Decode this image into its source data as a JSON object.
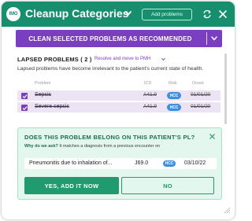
{
  "header": {
    "logo_text": "IMO",
    "title": "Cleanup Categories",
    "add_problems_label": "Add problems",
    "icons": [
      "chevron-down-icon",
      "refresh-icon",
      "close-icon"
    ]
  },
  "action_button": {
    "label": "CLEAN SELECTED PROBLEMS AS RECOMMENDED"
  },
  "lapsed": {
    "title": "LAPSED PROBLEMS ( 2 )",
    "action_link": "Resolve and move to PMH",
    "description": "Lapsed problems have become irrelevant to the patient's current state of health.",
    "columns": [
      "Problem",
      "ICD",
      "Risk",
      "Onset"
    ],
    "rows": [
      {
        "name": "Sepsis",
        "icd": "A41.9",
        "risk": "HCC",
        "onset": "01/01/20",
        "checked": true
      },
      {
        "name": "Severe sepsis",
        "icd": "A41.9",
        "risk": "HCC",
        "onset": "01/01/20",
        "checked": true
      }
    ]
  },
  "suggestion": {
    "question": "DOES THIS PROBLEM BELONG ON THIS PATIENT'S PL?",
    "why_label": "Why do we ask?",
    "why_text": "It matches a diagnosis from a previous encounter on",
    "match": {
      "name": "Pneumonitis due to inhalation of...",
      "icd": "J69.0",
      "risk": "HCC",
      "date": "03/10/22"
    },
    "yes_label": "YES, ADD IT NOW",
    "no_label": "NO"
  },
  "colors": {
    "header_green": "#178f6e",
    "action_purple": "#7a3fc1",
    "hcc_blue": "#3b8ee0",
    "suggest_bg": "#e3f7ee"
  }
}
